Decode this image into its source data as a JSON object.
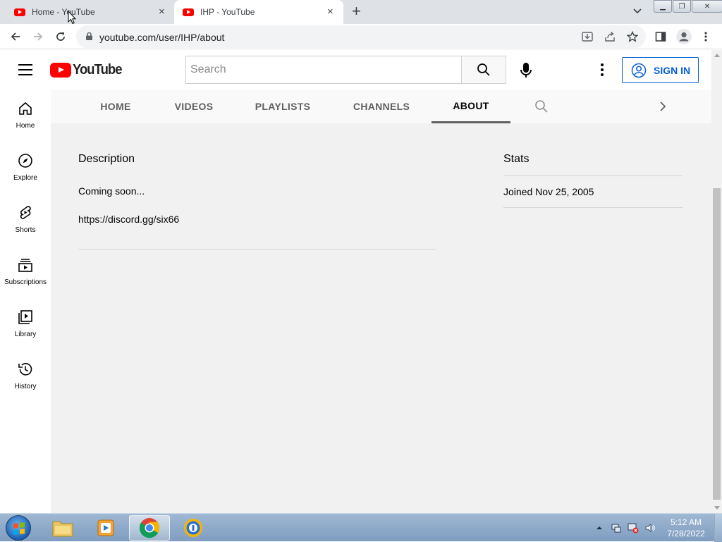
{
  "browser": {
    "tabs": [
      {
        "title": "Home - YouTube",
        "active": false
      },
      {
        "title": "IHP - YouTube",
        "active": true
      }
    ],
    "close_glyph": "×",
    "new_tab_glyph": "+",
    "window_buttons": {
      "minimize": "▁",
      "restore": "❐",
      "close": "✕"
    },
    "url": "youtube.com/user/IHP/about"
  },
  "youtube": {
    "logo_text": "YouTube",
    "search_placeholder": "Search",
    "sign_in": "SIGN IN",
    "guide": [
      {
        "label": "Home",
        "icon": "home-icon"
      },
      {
        "label": "Explore",
        "icon": "compass-icon"
      },
      {
        "label": "Shorts",
        "icon": "shorts-icon"
      },
      {
        "label": "Subscriptions",
        "icon": "subscriptions-icon"
      },
      {
        "label": "Library",
        "icon": "library-icon"
      },
      {
        "label": "History",
        "icon": "history-icon"
      }
    ],
    "channel_tabs": [
      {
        "label": "HOME",
        "active": false
      },
      {
        "label": "VIDEOS",
        "active": false
      },
      {
        "label": "PLAYLISTS",
        "active": false
      },
      {
        "label": "CHANNELS",
        "active": false
      },
      {
        "label": "ABOUT",
        "active": true
      }
    ],
    "about": {
      "description_title": "Description",
      "description_lines": [
        "Coming soon...",
        "https://discord.gg/six66"
      ],
      "stats_title": "Stats",
      "joined": "Joined Nov 25, 2005"
    }
  },
  "taskbar": {
    "time": "5:12 AM",
    "date": "7/28/2022",
    "apps": [
      "file-explorer",
      "media-player",
      "chrome",
      "security-app"
    ]
  },
  "colors": {
    "youtube_red": "#ff0000",
    "link_blue": "#065fd4",
    "page_bg": "#f1f1f1"
  }
}
